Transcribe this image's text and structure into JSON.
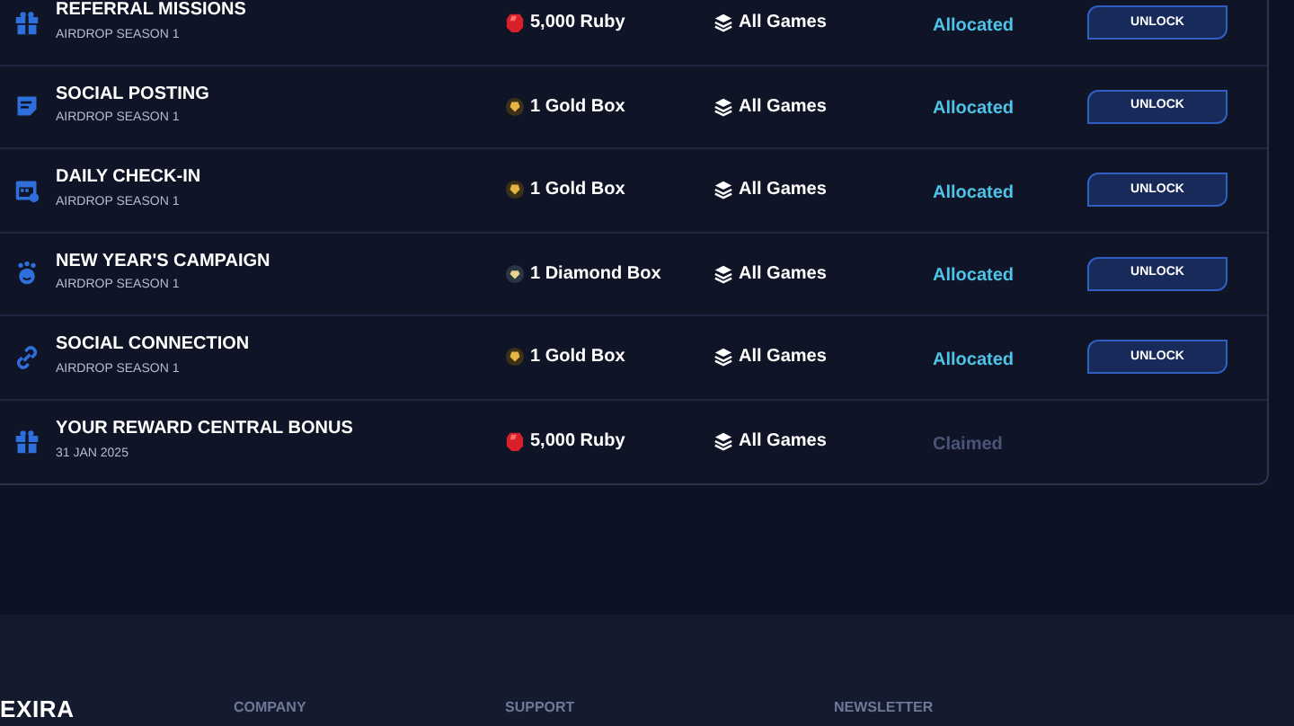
{
  "missions": [
    {
      "kind": "gift",
      "title": "REFERRAL MISSIONS",
      "subtitle": "AIRDROP SEASON 1",
      "reward": {
        "kind": "ruby",
        "text": "5,000 Ruby"
      },
      "game": "All Games",
      "status": {
        "kind": "allocated",
        "text": "Allocated"
      },
      "action": "UNLOCK"
    },
    {
      "kind": "post",
      "title": "SOCIAL POSTING",
      "subtitle": "AIRDROP SEASON 1",
      "reward": {
        "kind": "gold",
        "text": "1 Gold Box"
      },
      "game": "All Games",
      "status": {
        "kind": "allocated",
        "text": "Allocated"
      },
      "action": "UNLOCK"
    },
    {
      "kind": "calendar",
      "title": "DAILY CHECK-IN",
      "subtitle": "AIRDROP SEASON 1",
      "reward": {
        "kind": "gold",
        "text": "1 Gold Box"
      },
      "game": "All Games",
      "status": {
        "kind": "allocated",
        "text": "Allocated"
      },
      "action": "UNLOCK"
    },
    {
      "kind": "newyear",
      "title": "NEW YEAR'S CAMPAIGN",
      "subtitle": "AIRDROP SEASON 1",
      "reward": {
        "kind": "diamond",
        "text": "1 Diamond Box"
      },
      "game": "All Games",
      "status": {
        "kind": "allocated",
        "text": "Allocated"
      },
      "action": "UNLOCK"
    },
    {
      "kind": "link",
      "title": "SOCIAL CONNECTION",
      "subtitle": "AIRDROP SEASON 1",
      "reward": {
        "kind": "gold",
        "text": "1 Gold Box"
      },
      "game": "All Games",
      "status": {
        "kind": "allocated",
        "text": "Allocated"
      },
      "action": "UNLOCK"
    },
    {
      "kind": "gift",
      "title": "YOUR REWARD CENTRAL BONUS",
      "subtitle": "31 JAN 2025",
      "reward": {
        "kind": "ruby",
        "text": "5,000 Ruby"
      },
      "game": "All Games",
      "status": {
        "kind": "claimed",
        "text": "Claimed"
      }
    }
  ],
  "footer": {
    "logo": "EXIRA",
    "columns": [
      "COMPANY",
      "SUPPORT",
      "NEWSLETTER"
    ]
  }
}
